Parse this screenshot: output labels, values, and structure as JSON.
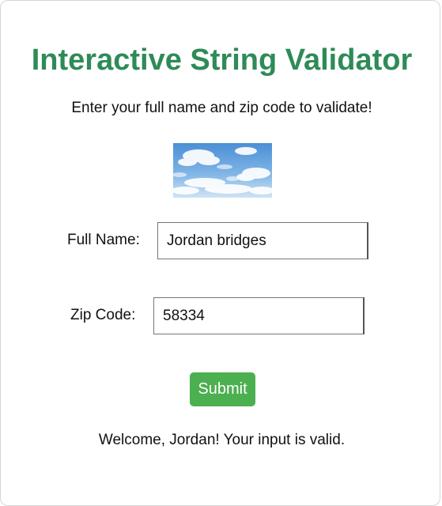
{
  "header": {
    "title": "Interactive String Validator",
    "subtitle": "Enter your full name and zip code to validate!"
  },
  "image": {
    "icon": "sky-clouds-image"
  },
  "form": {
    "name_label": "Full Name:",
    "name_value": "Jordan bridges",
    "zip_label": "Zip Code:",
    "zip_value": "58334",
    "submit_label": "Submit"
  },
  "result": {
    "message": "Welcome, Jordan! Your input is valid."
  },
  "colors": {
    "title": "#2e8b57",
    "button": "#4caf50",
    "button_text": "#ffffff"
  }
}
